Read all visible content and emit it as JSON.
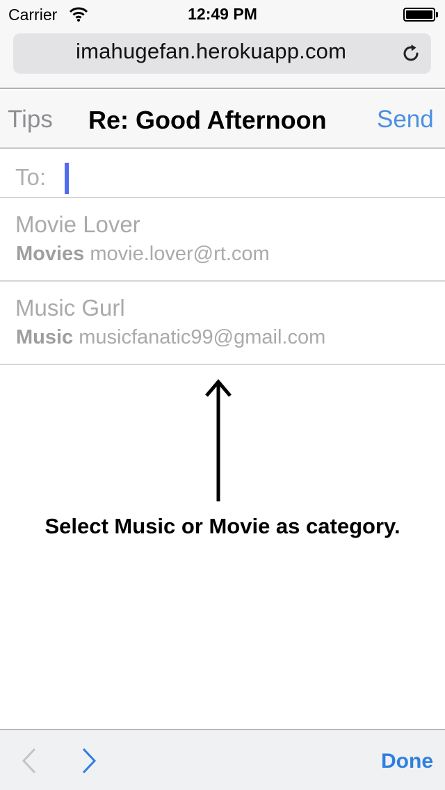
{
  "status_bar": {
    "carrier": "Carrier",
    "time": "12:49 PM"
  },
  "address_bar": {
    "url": "imahugefan.herokuapp.com"
  },
  "nav": {
    "back_label": "Tips",
    "title": "Re: Good Afternoon",
    "action_label": "Send"
  },
  "compose": {
    "to_label": "To:",
    "to_value": ""
  },
  "suggestions": [
    {
      "name": "Movie Lover",
      "category": "Movies",
      "email": "movie.lover@rt.com"
    },
    {
      "name": "Music Gurl",
      "category": "Music",
      "email": "musicfanatic99@gmail.com"
    }
  ],
  "hint": "Select Music or Movie as category.",
  "toolbar": {
    "prev_icon": "chevron-left",
    "next_icon": "chevron-right",
    "done_label": "Done"
  },
  "colors": {
    "accent": "#4a90e2",
    "cursor": "#4f6df0",
    "done": "#2f7fe0"
  }
}
